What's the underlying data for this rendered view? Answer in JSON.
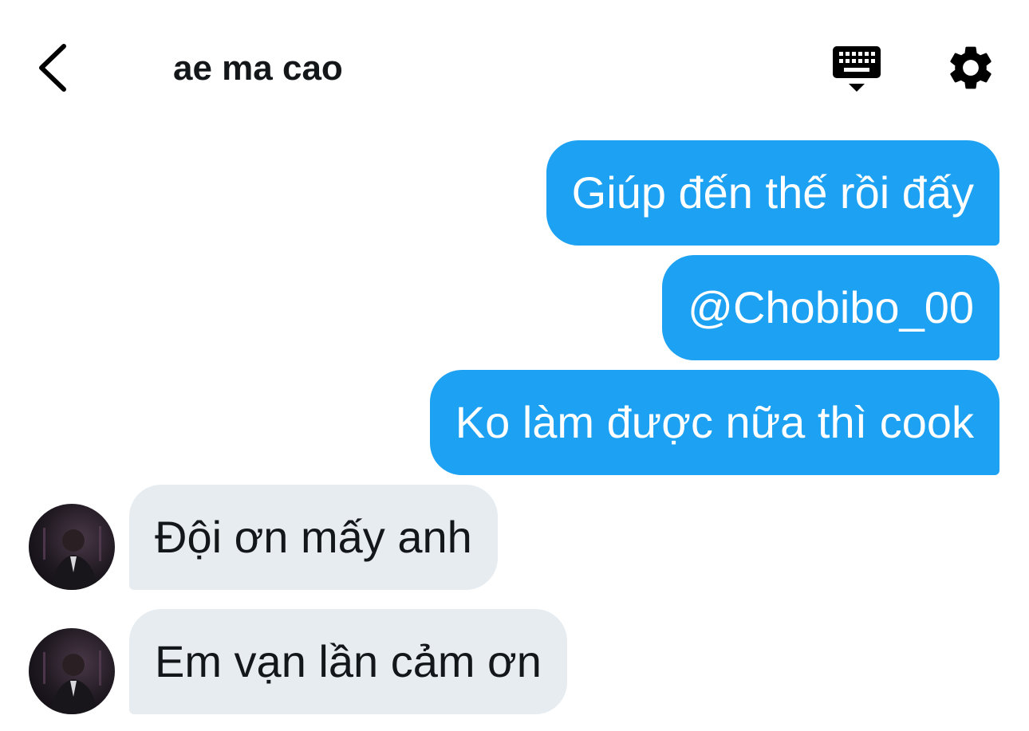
{
  "header": {
    "title": "ae ma cao",
    "back_icon": "chevron-left-icon",
    "keyboard_icon": "keyboard-icon",
    "settings_icon": "gear-icon"
  },
  "colors": {
    "outgoing_bubble": "#1da1f2",
    "incoming_bubble": "#e6ecf0",
    "text_dark": "#14171a",
    "text_light": "#ffffff"
  },
  "messages": [
    {
      "direction": "outgoing",
      "text": "Giúp đến thế rồi đấy"
    },
    {
      "direction": "outgoing",
      "text": "@Chobibo_00"
    },
    {
      "direction": "outgoing",
      "text": "Ko làm được nữa thì cook"
    },
    {
      "direction": "incoming",
      "text": "Đội ơn mấy anh"
    },
    {
      "direction": "incoming",
      "text": "Em vạn lần cảm ơn"
    }
  ]
}
